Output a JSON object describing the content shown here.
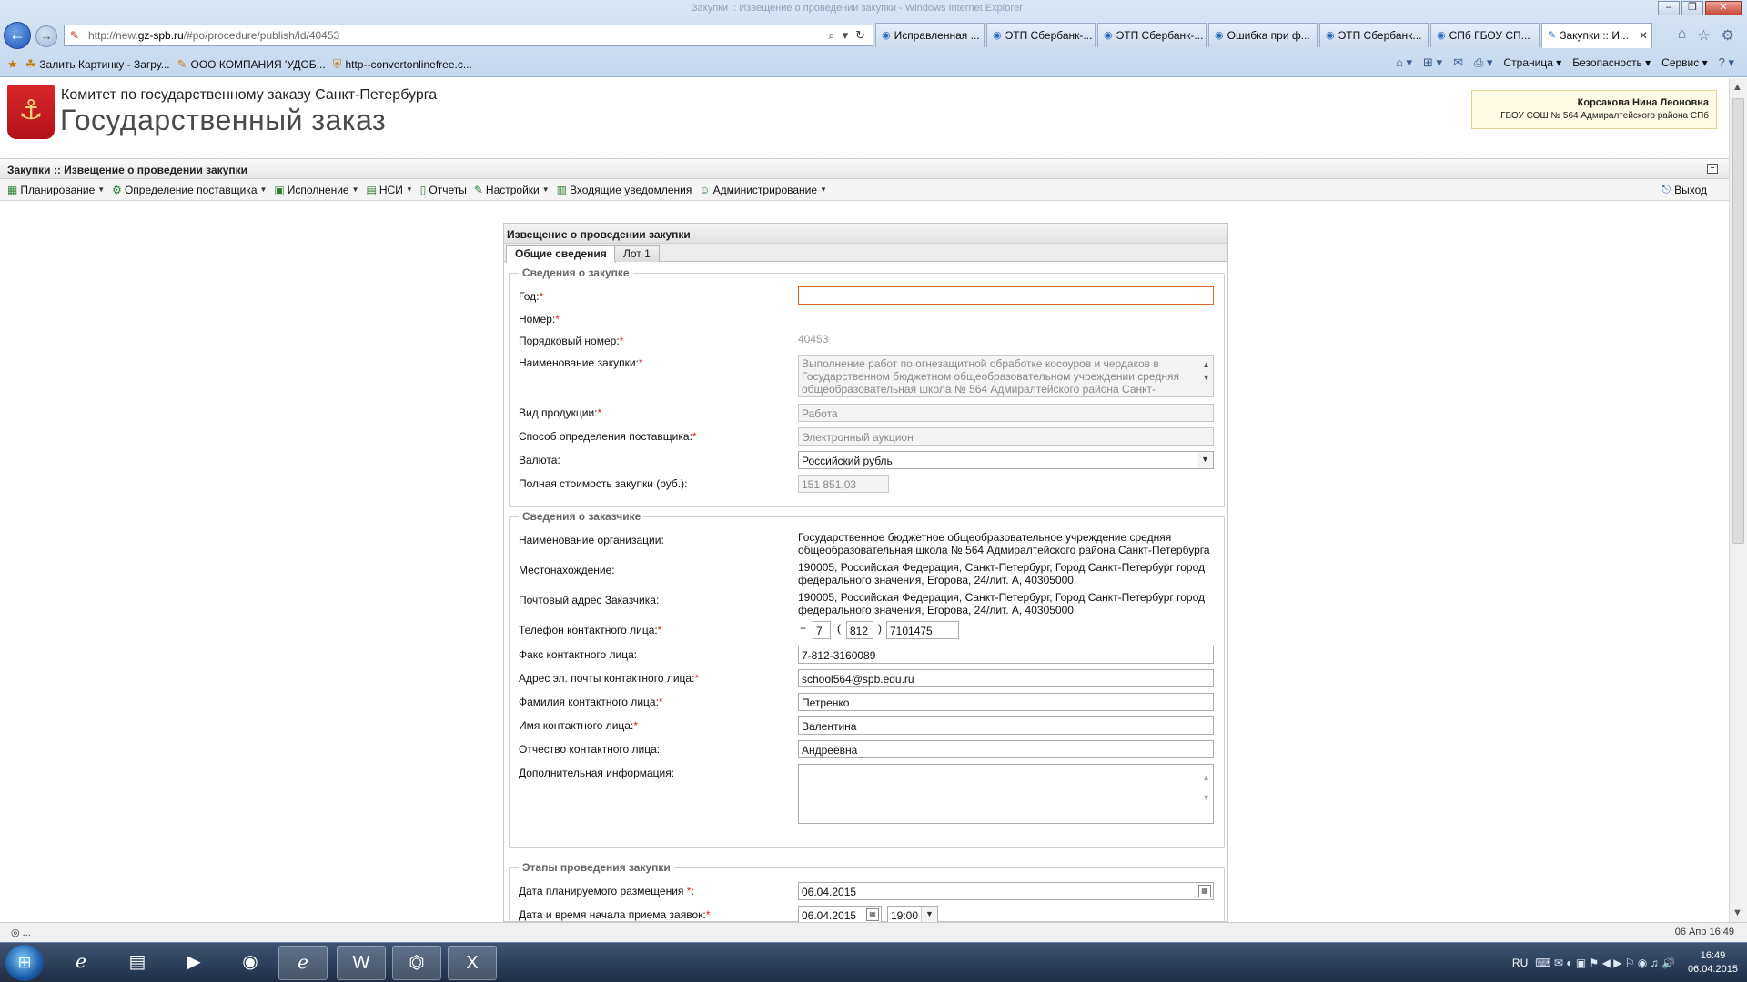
{
  "browser": {
    "window_title": "Закупки :: Извещение о проведении закупки - Windows Internet Explorer",
    "address": {
      "prefix": "http://new.",
      "host": "gz-spb.ru",
      "path": "/#po/procedure/publish/id/40453"
    },
    "tabs": [
      {
        "label": "Исправленная ..."
      },
      {
        "label": "ЭТП Сбербанк-..."
      },
      {
        "label": "ЭТП Сбербанк-..."
      },
      {
        "label": "Ошибка при ф..."
      },
      {
        "label": "ЭТП Сбербанк..."
      },
      {
        "label": "СПб ГБОУ СП..."
      },
      {
        "label": "Закупки :: И..."
      }
    ],
    "favorites": [
      "Залить Картинку - Загру...",
      "ООО КОМПАНИЯ 'УДОБ...",
      "http--convertonlinefree.c..."
    ],
    "commands": [
      "Страница",
      "Безопасность",
      "Сервис"
    ]
  },
  "site": {
    "org_line1": "Комитет по государственному заказу Санкт-Петербурга",
    "org_line2": "Государственный заказ",
    "user_name": "Корсакова Нина Леоновна",
    "user_org": "ГБОУ СОШ № 564 Адмиралтейского района СПб",
    "breadcrumb": "Закупки :: Извещение о проведении закупки",
    "menu": [
      "Планирование",
      "Определение поставщика",
      "Исполнение",
      "НСИ",
      "Отчеты",
      "Настройки",
      "Входящие уведомления",
      "Администрирование"
    ],
    "exit": "Выход"
  },
  "form": {
    "title": "Извещение о проведении закупки",
    "tabs": [
      "Общие сведения",
      "Лот 1"
    ],
    "section1": {
      "legend": "Сведения о закупке",
      "year_label": "Год:",
      "year_value": "",
      "number_label": "Номер:",
      "serial_label": "Порядковый номер:",
      "serial_value": "40453",
      "name_label": "Наименование закупки:",
      "name_value": "Выполнение работ по огнезащитной обработке косоуров и чердаков в Государственном бюджетном общеобразовательном учреждении средняя общеобразовательная школа № 564 Адмиралтейского района Санкт-",
      "product_label": "Вид продукции:",
      "product_value": "Работа",
      "method_label": "Способ определения поставщика:",
      "method_value": "Электронный аукцион",
      "currency_label": "Валюта:",
      "currency_value": "Российский рубль",
      "cost_label": "Полная стоимость закупки (руб.):",
      "cost_value": "151 851,03"
    },
    "section2": {
      "legend": "Сведения о заказчике",
      "org_label": "Наименование организации:",
      "org_value": "Государственное бюджетное общеобразовательное учреждение средняя общеобразовательная школа № 564 Адмиралтейского района Санкт-Петербурга",
      "location_label": "Местонахождение:",
      "location_value": "190005, Российская Федерация, Санкт-Петербург, Город Санкт-Петербург город федерального значения, Егорова, 24/лит. А, 40305000",
      "postal_label": "Почтовый адрес Заказчика:",
      "postal_value": "190005, Российская Федерация, Санкт-Петербург, Город Санкт-Петербург город федерального значения, Егорова, 24/лит. А, 40305000",
      "phone_label": "Телефон контактного лица:",
      "phone_plus": "+",
      "phone_country": "7",
      "phone_open": "(",
      "phone_code": "812",
      "phone_close": ")",
      "phone_number": "7101475",
      "fax_label": "Факс контактного лица:",
      "fax_value": "7-812-3160089",
      "email_label": "Адрес эл. почты контактного лица:",
      "email_value": "school564@spb.edu.ru",
      "lastname_label": "Фамилия контактного лица:",
      "lastname_value": "Петренко",
      "firstname_label": "Имя контактного лица:",
      "firstname_value": "Валентина",
      "patronymic_label": "Отчество контактного лица:",
      "patronymic_value": "Андреевна",
      "extra_label": "Дополнительная информация:",
      "extra_value": ""
    },
    "section3": {
      "legend": "Этапы проведения закупки",
      "plan_label": "Дата планируемого размещения",
      "plan_value": "06.04.2015",
      "start_label": "Дата и время начала приема заявок:",
      "start_date": "06.04.2015",
      "start_time": "19:00"
    }
  },
  "status": {
    "left": "◎ ...",
    "right": "06 Апр 16:49"
  },
  "taskbar": {
    "lang": "RU",
    "time": "16:49",
    "date": "06.04.2015"
  }
}
